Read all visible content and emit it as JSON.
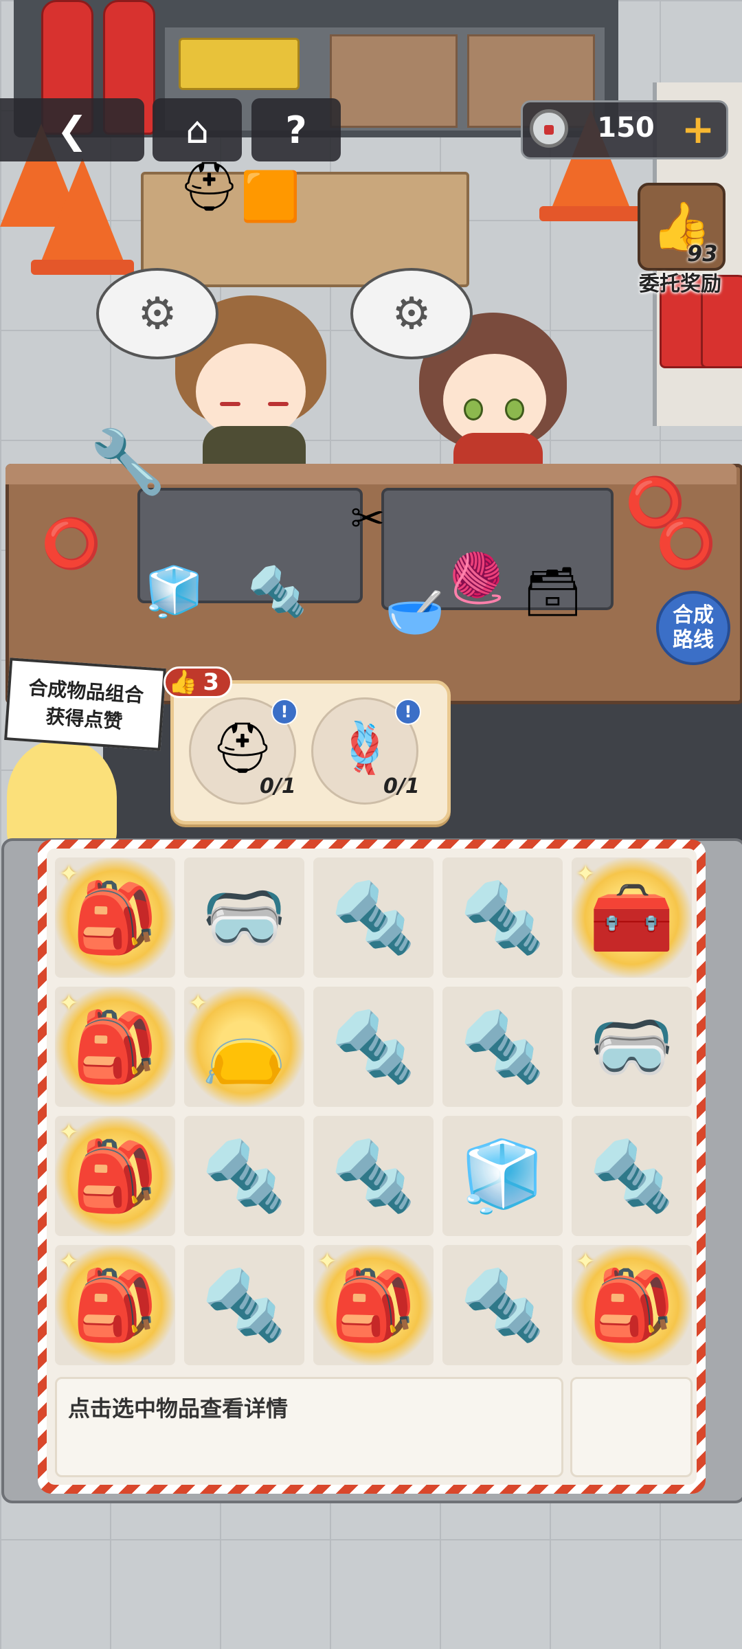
{
  "nav": {
    "back_icon": "chevron-left-icon",
    "home_icon": "home-icon",
    "help_label": "?"
  },
  "currency": {
    "icon": "tape-roll-icon",
    "value": "150",
    "add_label": "+"
  },
  "reward": {
    "icon": "thumbs-up-icon",
    "count": "93",
    "label": "委托奖励"
  },
  "route_button": {
    "line1": "合成",
    "line2": "路线"
  },
  "sign": {
    "line1": "合成物品组合",
    "line2": "获得点赞"
  },
  "likes": {
    "count": "3"
  },
  "tasks": [
    {
      "name": "safety-helmet",
      "icon": "⛑",
      "progress": "0/1",
      "alert": "!"
    },
    {
      "name": "rope-carabiner",
      "icon": "🪢",
      "progress": "0/1",
      "alert": "!"
    }
  ],
  "inventory": {
    "rows": [
      [
        {
          "name": "rescue-backpack",
          "icon": "🎒",
          "glow": true
        },
        {
          "name": "face-shield",
          "icon": "🥽",
          "glow": false
        },
        {
          "name": "anchor-bolt",
          "icon": "🔩",
          "glow": false
        },
        {
          "name": "anchor-bolt",
          "icon": "🔩",
          "glow": false
        },
        {
          "name": "first-aid-bag",
          "icon": "🧰",
          "glow": true
        }
      ],
      [
        {
          "name": "rescue-backpack",
          "icon": "🎒",
          "glow": true
        },
        {
          "name": "drawstring-bag",
          "icon": "👝",
          "glow": true
        },
        {
          "name": "anchor-bolt",
          "icon": "🔩",
          "glow": false
        },
        {
          "name": "anchor-bolt",
          "icon": "🔩",
          "glow": false
        },
        {
          "name": "safety-goggles",
          "icon": "🥽",
          "glow": false
        }
      ],
      [
        {
          "name": "rescue-backpack",
          "icon": "🎒",
          "glow": true
        },
        {
          "name": "anchor-bolt",
          "icon": "🔩",
          "glow": false
        },
        {
          "name": "anchor-bolt",
          "icon": "🔩",
          "glow": false
        },
        {
          "name": "ice-cubes",
          "icon": "🧊",
          "glow": false
        },
        {
          "name": "anchor-bolt",
          "icon": "🔩",
          "glow": false
        }
      ],
      [
        {
          "name": "rescue-backpack",
          "icon": "🎒",
          "glow": true
        },
        {
          "name": "anchor-bolt",
          "icon": "🔩",
          "glow": false
        },
        {
          "name": "rescue-backpack",
          "icon": "🎒",
          "glow": true
        },
        {
          "name": "anchor-bolt",
          "icon": "🔩",
          "glow": false
        },
        {
          "name": "rescue-backpack",
          "icon": "🎒",
          "glow": true
        }
      ]
    ],
    "detail_text": "点击选中物品查看详情"
  }
}
